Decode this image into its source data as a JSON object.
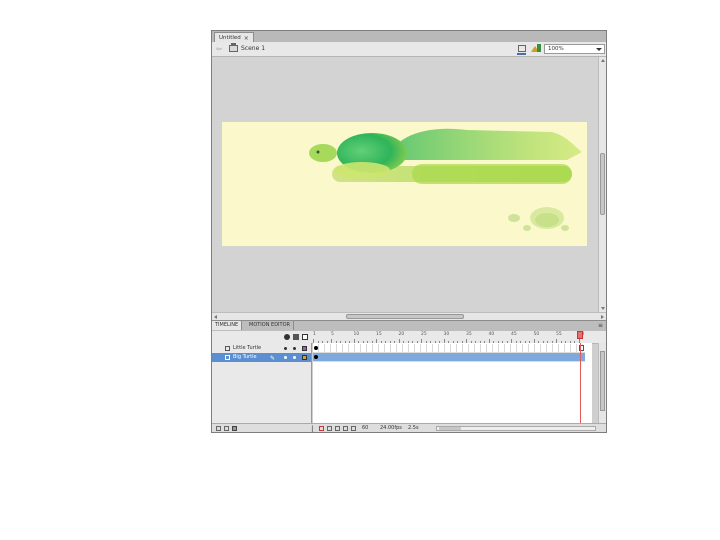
{
  "document": {
    "tab_label": "Untitled",
    "close_glyph": "×"
  },
  "edit_bar": {
    "back_glyph": "⇦",
    "scene_label": "Scene 1",
    "zoom": "100%"
  },
  "panel": {
    "tabs": [
      "TIMELINE",
      "MOTION EDITOR"
    ],
    "menu_glyph": "≡"
  },
  "timeline": {
    "ruler": [
      "1",
      "5",
      "10",
      "15",
      "20",
      "25",
      "30",
      "35",
      "40",
      "45",
      "50",
      "55",
      "60"
    ],
    "layers": [
      {
        "name": "Little Turtle",
        "color": "#9b59c9",
        "selected": false
      },
      {
        "name": "Big Turtle",
        "color": "#c9a13a",
        "selected": true
      }
    ],
    "footer": {
      "current_frame": "60",
      "fps": "24.00fps",
      "elapsed": "2.5s"
    }
  },
  "stage": {
    "background": "#fbf9cc"
  }
}
